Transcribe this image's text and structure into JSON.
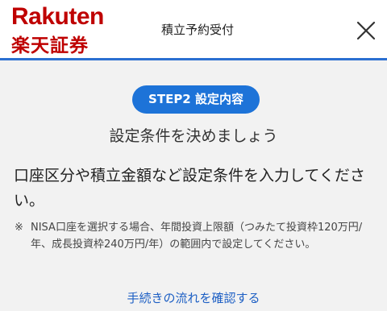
{
  "header": {
    "logo_en": "Rakuten",
    "logo_jp": "楽天証券",
    "title": "積立予約受付",
    "close_icon": "close-icon",
    "accent_color": "#bf0000",
    "rule_color": "#2b6fd1"
  },
  "main": {
    "step_badge": "STEP2 設定内容",
    "heading": "設定条件を決めましょう",
    "description": "口座区分や積立金額など設定条件を入力してください。",
    "note_mark": "※",
    "note_text": "NISA口座を選択する場合、年間投資上限額（つみたて投資枠120万円/年、成長投資枠240万円/年）の範囲内で設定してください。",
    "link": "手続きの流れを確認する",
    "badge_color": "#1d73d8",
    "link_color": "#1d5fc4"
  }
}
